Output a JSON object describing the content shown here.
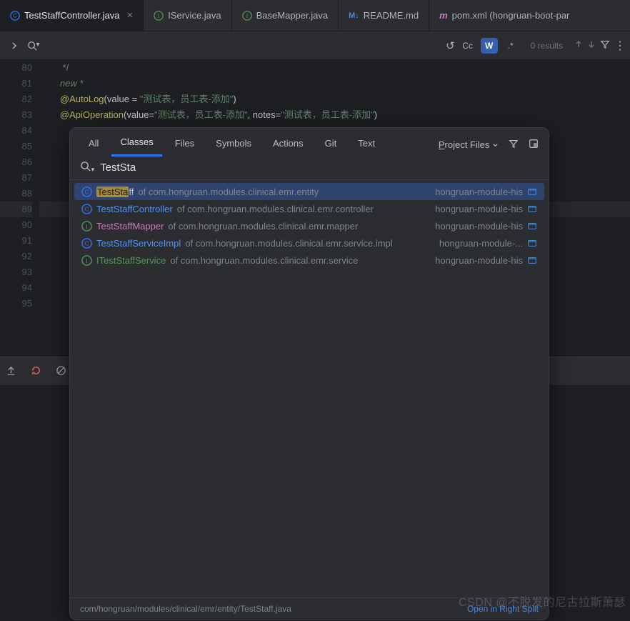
{
  "tabs": [
    {
      "label": "TestStaffController.java",
      "type": "class",
      "active": true
    },
    {
      "label": "IService.java",
      "type": "interface"
    },
    {
      "label": "BaseMapper.java",
      "type": "interface"
    },
    {
      "label": "README.md",
      "type": "md"
    },
    {
      "label": "pom.xml (hongruan-boot-par",
      "type": "pom"
    }
  ],
  "findbar": {
    "results_text": "0 results",
    "toggles": {
      "cc": "Cc",
      "w": "W",
      "regex": ".*"
    }
  },
  "gutter_lines": [
    "80",
    "81",
    "82",
    "83",
    "84",
    "85",
    "86",
    "87",
    "88",
    "89",
    "90",
    "91",
    "92",
    "93",
    "94",
    "95"
  ],
  "code": {
    "l80": "         */",
    "l81_pre": "new *",
    "autolog": "@AutoLog",
    "autolog_args": "value = ",
    "autolog_str": "\"测试表，员工表-添加\"",
    "apiop": "@ApiOperation",
    "apiop_args1": "value=",
    "apiop_str1": "\"测试表，员工表-添加\"",
    "apiop_args2": ", notes=",
    "apiop_str2": "\"测试表，员工表-添加\""
  },
  "popup": {
    "tabs": [
      "All",
      "Classes",
      "Files",
      "Symbols",
      "Actions",
      "Git",
      "Text"
    ],
    "active_tab": "Classes",
    "scope": "Project Files",
    "query": "TestSta",
    "results": [
      {
        "icon": "class",
        "name": "TestStaff",
        "hl": "TestSta",
        "of": " of com.hongruan.modules.clinical.emr.entity",
        "module": "hongruan-module-his",
        "selected": true
      },
      {
        "icon": "class",
        "name": "TestStaffController",
        "hl": "TestStaff",
        "of": " of com.hongruan.modules.clinical.emr.controller",
        "module": "hongruan-module-his"
      },
      {
        "icon": "interface",
        "name": "TestStaffMapper",
        "hl": "",
        "of": " of com.hongruan.modules.clinical.emr.mapper",
        "module": "hongruan-module-his"
      },
      {
        "icon": "class",
        "name": "TestStaffServiceImpl",
        "hl": "",
        "of": " of com.hongruan.modules.clinical.emr.service.impl",
        "module": "hongruan-module-..."
      },
      {
        "icon": "interface",
        "name": "ITestStaffService",
        "hl": "",
        "of": " of com.hongruan.modules.clinical.emr.service",
        "module": "hongruan-module-his"
      }
    ],
    "footer_path": "com/hongruan/modules/clinical/emr/entity/TestStaff.java",
    "open_split": "Open in Right Split"
  },
  "watermark": "CSDN @不脱发的尼古拉斯萧瑟"
}
